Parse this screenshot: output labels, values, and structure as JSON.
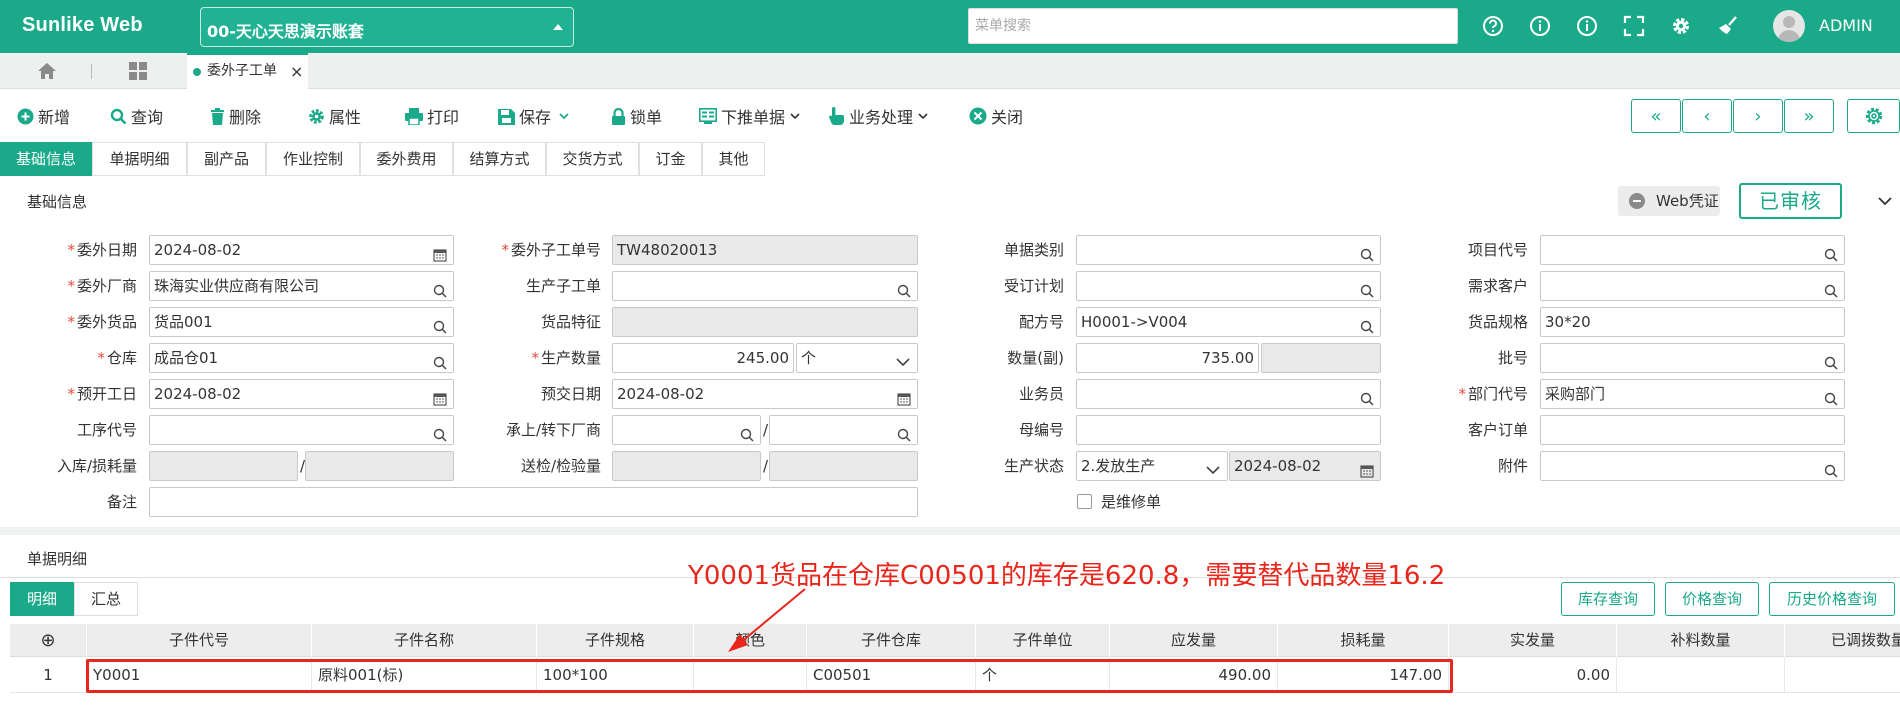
{
  "app": {
    "title": "Sunlike Web",
    "account": "00-天心天思演示账套",
    "search_placeholder": "菜单搜索",
    "user": "ADMIN"
  },
  "page_tab": {
    "label": "委外子工单",
    "close": "×"
  },
  "toolbar": {
    "add": "新增",
    "query": "查询",
    "delete": "删除",
    "props": "属性",
    "print": "打印",
    "save": "保存",
    "lock": "锁单",
    "push": "下推单据",
    "business": "业务处理",
    "close": "关闭"
  },
  "nav": {
    "first": "«",
    "prev": "‹",
    "next": "›",
    "last": "»"
  },
  "subtabs": [
    "基础信息",
    "单据明细",
    "副产品",
    "作业控制",
    "委外费用",
    "结算方式",
    "交货方式",
    "订金",
    "其他"
  ],
  "section": {
    "basic": "基础信息",
    "web_voucher": "Web凭证",
    "status_stamp": "已审核",
    "detail": "单据明细"
  },
  "form": {
    "entrust_date": {
      "label": "委外日期",
      "value": "2024-08-02"
    },
    "entrust_order": {
      "label": "委外子工单号",
      "value": "TW48020013"
    },
    "doc_type": {
      "label": "单据类别",
      "value": ""
    },
    "project_code": {
      "label": "项目代号",
      "value": ""
    },
    "vendor": {
      "label": "委外厂商",
      "value": "珠海实业供应商有限公司"
    },
    "prod_order": {
      "label": "生产子工单",
      "value": ""
    },
    "order_plan": {
      "label": "受订计划",
      "value": ""
    },
    "demand_customer": {
      "label": "需求客户",
      "value": ""
    },
    "goods": {
      "label": "委外货品",
      "value": "货品001"
    },
    "goods_feature": {
      "label": "货品特征",
      "value": ""
    },
    "formula": {
      "label": "配方号",
      "value": "H0001->V004"
    },
    "goods_spec": {
      "label": "货品规格",
      "value": "30*20"
    },
    "warehouse": {
      "label": "仓库",
      "value": "成品仓01"
    },
    "prod_qty": {
      "label": "生产数量",
      "value": "245.00",
      "unit": "个"
    },
    "qty_sub": {
      "label": "数量(副)",
      "value": "735.00"
    },
    "batch": {
      "label": "批号",
      "value": ""
    },
    "plan_start": {
      "label": "预开工日",
      "value": "2024-08-02"
    },
    "plan_delivery": {
      "label": "预交日期",
      "value": "2024-08-02"
    },
    "salesman": {
      "label": "业务员",
      "value": ""
    },
    "dept": {
      "label": "部门代号",
      "value": "采购部门"
    },
    "process_code": {
      "label": "工序代号",
      "value": ""
    },
    "transfer_vendor": {
      "label": "承上/转下厂商",
      "value": ""
    },
    "parent_no": {
      "label": "母编号",
      "value": ""
    },
    "customer_order": {
      "label": "客户订单",
      "value": ""
    },
    "in_loss": {
      "label": "入库/损耗量",
      "value": ""
    },
    "inspect": {
      "label": "送检/检验量",
      "value": ""
    },
    "prod_status": {
      "label": "生产状态",
      "value": "2.发放生产",
      "date": "2024-08-02"
    },
    "attachment": {
      "label": "附件",
      "value": ""
    },
    "remark": {
      "label": "备注",
      "value": ""
    },
    "repair": {
      "label": "是维修单"
    }
  },
  "detail_tabs": {
    "detail": "明细",
    "summary": "汇总"
  },
  "detail_buttons": {
    "stock": "库存查询",
    "price": "价格查询",
    "history": "历史价格查询"
  },
  "grid": {
    "add_icon": "⊕",
    "columns": [
      "子件代号",
      "子件名称",
      "子件规格",
      "颜色",
      "子件仓库",
      "子件单位",
      "应发量",
      "损耗量",
      "实发量",
      "补料数量",
      "已调拨数量"
    ],
    "rows": [
      {
        "no": "1",
        "code": "Y0001",
        "name": "原料001(标)",
        "spec": "100*100",
        "color": "",
        "wh": "C00501",
        "unit": "个",
        "should": "490.00",
        "loss": "147.00",
        "actual": "0.00",
        "supp": "",
        "trans": ""
      }
    ]
  },
  "annotation": "Y0001货品在仓库C00501的库存是620.8，需要替代品数量16.2",
  "colors": {
    "brand": "#1aaa8a",
    "annotation": "#e8261b"
  }
}
